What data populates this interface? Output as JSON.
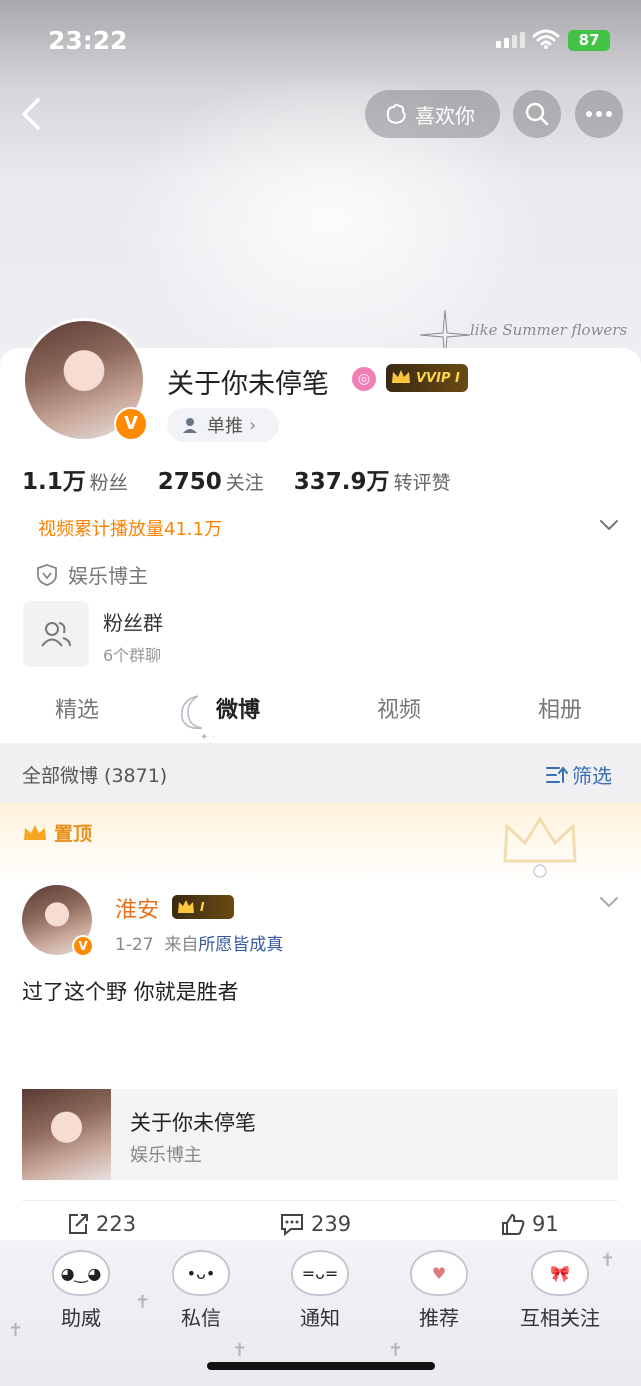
{
  "status_bar": {
    "time": "23:22",
    "battery": "87"
  },
  "header": {
    "like_label": "喜欢你",
    "cover_script": "like Summer flowers\n♪ life"
  },
  "profile": {
    "name": "关于你未停笔",
    "vvip_label": "VVIP I",
    "dan_label": "单推",
    "stats": [
      {
        "value": "1.1万",
        "label": "粉丝"
      },
      {
        "value": "2750",
        "label": "关注"
      },
      {
        "value": "337.9万",
        "label": "转评赞"
      }
    ],
    "play_count": "视频累计播放量41.1万",
    "entertainment": "娱乐博主",
    "fans_group": {
      "title": "粉丝群",
      "subtitle": "6个群聊"
    }
  },
  "tabs": [
    "精选",
    "微博",
    "视频",
    "相册"
  ],
  "feed": {
    "all_label": "全部微博 (3871)",
    "filter_label": "筛选",
    "pinned_label": "置顶"
  },
  "post": {
    "author": "淮安",
    "badge": "I",
    "date": "1-27",
    "source_prefix": "来自",
    "source": "所愿皆成真",
    "text": "过了这个野 你就是胜者",
    "share_title": "关于你未停笔",
    "share_sub": "娱乐博主",
    "reposts": "223",
    "comments": "239",
    "likes": "91"
  },
  "bottom_nav": [
    "助威",
    "私信",
    "通知",
    "推荐",
    "互相关注"
  ]
}
